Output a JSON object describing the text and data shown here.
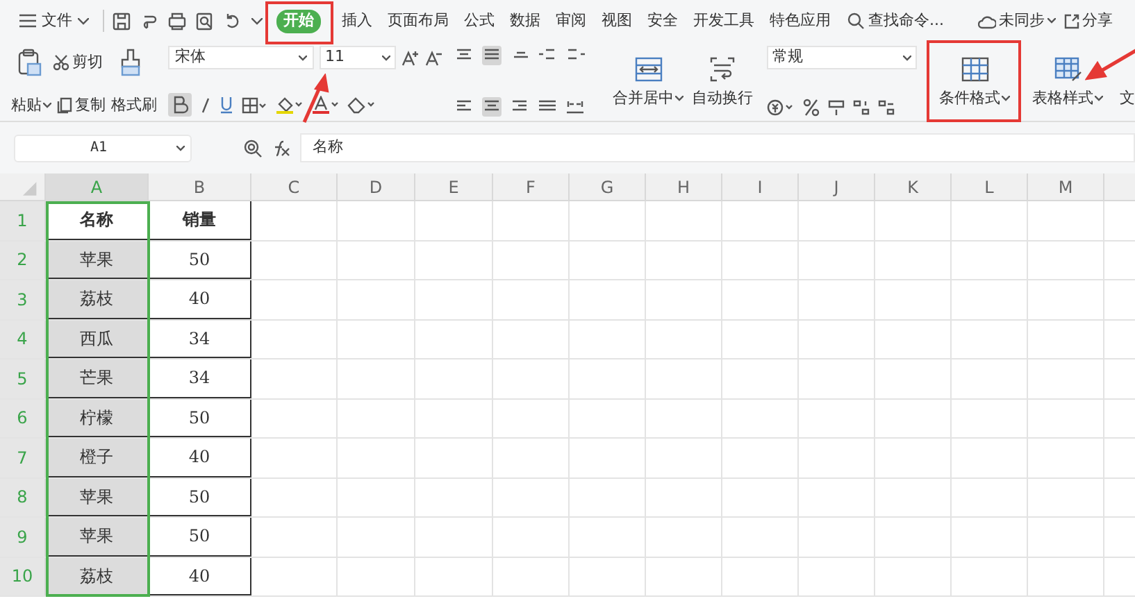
{
  "file_menu": {
    "label": "文件"
  },
  "tabs": [
    {
      "label": "开始",
      "selected": true
    },
    {
      "label": "插入",
      "selected": false
    },
    {
      "label": "页面布局",
      "selected": false
    },
    {
      "label": "公式",
      "selected": false
    },
    {
      "label": "数据",
      "selected": false
    },
    {
      "label": "审阅",
      "selected": false
    },
    {
      "label": "视图",
      "selected": false
    },
    {
      "label": "安全",
      "selected": false
    },
    {
      "label": "开发工具",
      "selected": false
    },
    {
      "label": "特色应用",
      "selected": false
    }
  ],
  "search": {
    "placeholder": "查找命令..."
  },
  "sync": {
    "label": "未同步"
  },
  "share": {
    "label": "分享"
  },
  "ribbon": {
    "paste": "粘贴",
    "cut": "剪切",
    "copy": "复制",
    "format_painter": "格式刷",
    "font_name": "宋体",
    "font_size": "11",
    "merge_center": "合并居中",
    "wrap_text": "自动换行",
    "number_format": "常规",
    "conditional_format": "条件格式",
    "table_style": "表格样式",
    "cut_off": "文"
  },
  "name_box": {
    "value": "A1"
  },
  "formula_bar": {
    "value": "名称"
  },
  "columns": [
    {
      "label": "A",
      "selected": true
    },
    {
      "label": "B",
      "selected": false
    },
    {
      "label": "C",
      "selected": false
    },
    {
      "label": "D",
      "selected": false
    },
    {
      "label": "E",
      "selected": false
    },
    {
      "label": "F",
      "selected": false
    },
    {
      "label": "G",
      "selected": false
    },
    {
      "label": "H",
      "selected": false
    },
    {
      "label": "I",
      "selected": false
    },
    {
      "label": "J",
      "selected": false
    },
    {
      "label": "K",
      "selected": false
    },
    {
      "label": "L",
      "selected": false
    },
    {
      "label": "M",
      "selected": false
    }
  ],
  "rows": [
    {
      "header": "1",
      "selected": true,
      "cells": [
        "名称",
        "销量"
      ]
    },
    {
      "header": "2",
      "selected": true,
      "cells": [
        "苹果",
        "50"
      ]
    },
    {
      "header": "3",
      "selected": true,
      "cells": [
        "荔枝",
        "40"
      ]
    },
    {
      "header": "4",
      "selected": true,
      "cells": [
        "西瓜",
        "34"
      ]
    },
    {
      "header": "5",
      "selected": true,
      "cells": [
        "芒果",
        "34"
      ]
    },
    {
      "header": "6",
      "selected": true,
      "cells": [
        "柠檬",
        "50"
      ]
    },
    {
      "header": "7",
      "selected": true,
      "cells": [
        "橙子",
        "40"
      ]
    },
    {
      "header": "8",
      "selected": true,
      "cells": [
        "苹果",
        "50"
      ]
    },
    {
      "header": "9",
      "selected": true,
      "cells": [
        "苹果",
        "50"
      ]
    },
    {
      "header": "10",
      "selected": true,
      "cells": [
        "荔枝",
        "40"
      ]
    }
  ]
}
